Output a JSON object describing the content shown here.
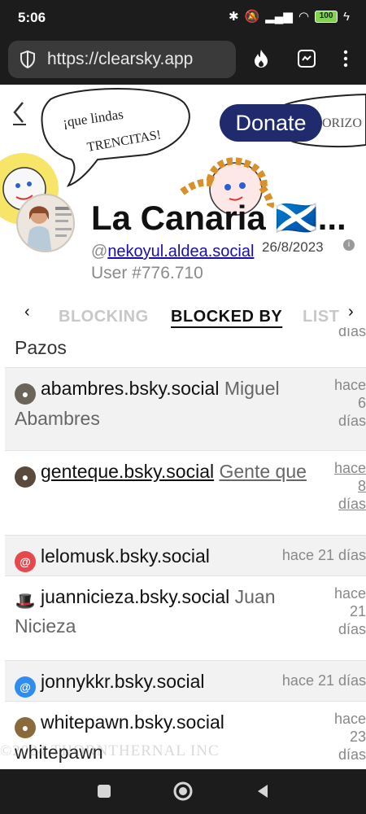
{
  "status": {
    "time": "5:06",
    "battery": "100"
  },
  "browser": {
    "url": "https://clearsky.app"
  },
  "banner": {
    "donate_label": "Donate",
    "speech_left": "¡que lindas TRENCITAS!",
    "speech_right": "ORIZO"
  },
  "profile": {
    "display_name": "La Canaria 🏴󠁧󠁢󠁳󠁣󠁴󠁿...",
    "handle_prefix": "@",
    "handle": "nekoyul.aldea.social",
    "joined": "26/8/2023",
    "user_number": "User #776.710"
  },
  "tabs": [
    {
      "label": "BLOCKING"
    },
    {
      "label": "BLOCKED BY"
    },
    {
      "label": "LIST"
    }
  ],
  "rows": [
    {
      "handle": "",
      "display": "Pazos",
      "time": "días"
    },
    {
      "handle": "abambres.bsky.social",
      "display": "Miguel Abambres",
      "time": "hace 6 días"
    },
    {
      "handle": "genteque.bsky.social",
      "display": "Gente que",
      "time": "hace 8 días"
    },
    {
      "handle": "lelomusk.bsky.social",
      "display": "",
      "time": "hace 21 días"
    },
    {
      "handle": "juannicieza.bsky.social",
      "display": "Juan Nicieza",
      "time": "hace 21 días"
    },
    {
      "handle": "jonnykkr.bsky.social",
      "display": "",
      "time": "hace 21 días"
    },
    {
      "handle": "whitepawn.bsky.social",
      "display": "whitepawn",
      "time": "hace 23 días"
    }
  ],
  "watermark": "©2024 THORNTHERNAL INC",
  "colors": {
    "donate_bg": "#1f2b6c",
    "link": "#1a0dab",
    "alt_row": "#f2f2f2"
  }
}
